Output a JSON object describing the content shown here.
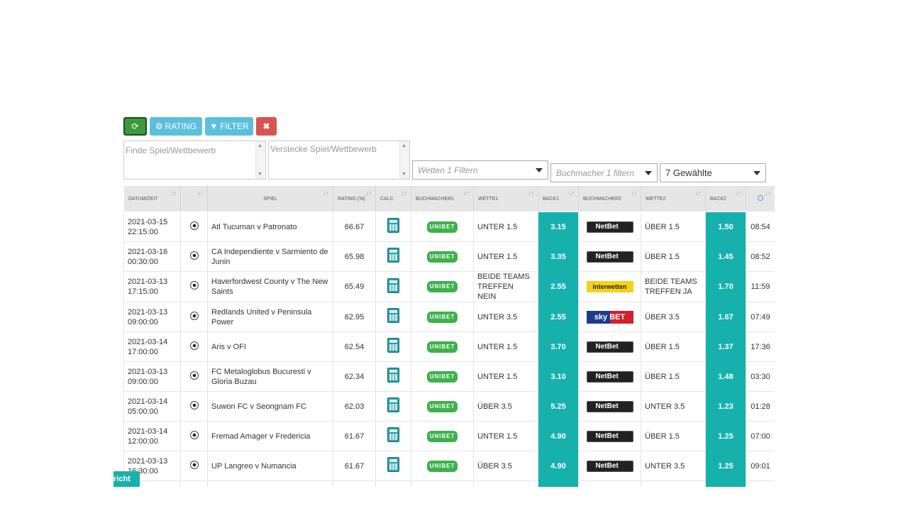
{
  "toolbar": {
    "rating_label": "RATING",
    "filter_label": "FILTER",
    "clear_label": "✖"
  },
  "filters": {
    "find_placeholder": "Finde Spiel/Wettbewerb",
    "hide_placeholder": "Verstecke Spiel/Wettbewerb",
    "wetten1_placeholder": "Wetten 1 Filtern",
    "bookmaker1_placeholder": "Buchmacher 1 filtern",
    "selected_label": "7 Gewählte"
  },
  "table": {
    "headers": {
      "datum": "DATUM/ZEIT",
      "spiel": "SPIEL",
      "rating": "RATING (%)",
      "calc": "CALC",
      "buch1": "BUCHMACHER1",
      "wette1": "WETTE1",
      "back1": "BACK1",
      "buch2": "BUCHMACHER2",
      "wette2": "WETTE2",
      "back2": "BACK2"
    },
    "rows": [
      {
        "date": "2021-03-15",
        "time": "22:15:00",
        "match": "Atl Tucuman v Patronato",
        "rating": "66.67",
        "bookie1": "UNIBET",
        "bet1": "UNTER 1.5",
        "back1": "3.15",
        "bookie2": "NetBet",
        "bet2": "ÜBER 1.5",
        "back2": "1.50",
        "updated": "08:54"
      },
      {
        "date": "2021-03-16",
        "time": "00:30:00",
        "match": "CA Independiente v Sarmiento de Junin",
        "rating": "65.98",
        "bookie1": "UNIBET",
        "bet1": "UNTER 1.5",
        "back1": "3.35",
        "bookie2": "NetBet",
        "bet2": "ÜBER 1.5",
        "back2": "1.45",
        "updated": "08:52"
      },
      {
        "date": "2021-03-13",
        "time": "17:15:00",
        "match": "Haverfordwest County v The New Saints",
        "rating": "65.49",
        "bookie1": "UNIBET",
        "bet1": "BEIDE TEAMS TREFFEN NEIN",
        "back1": "2.55",
        "bookie2": "interwetten",
        "bet2": "BEIDE TEAMS TREFFEN JA",
        "back2": "1.70",
        "updated": "11:59"
      },
      {
        "date": "2021-03-13",
        "time": "09:00:00",
        "match": "Redlands United v Peninsula Power",
        "rating": "62.95",
        "bookie1": "UNIBET",
        "bet1": "UNTER 3.5",
        "back1": "2.55",
        "bookie2": "sky BET",
        "bet2": "ÜBER 3.5",
        "back2": "1.67",
        "updated": "07:49"
      },
      {
        "date": "2021-03-14",
        "time": "17:00:00",
        "match": "Aris v OFI",
        "rating": "62.54",
        "bookie1": "UNIBET",
        "bet1": "UNTER 1.5",
        "back1": "3.70",
        "bookie2": "NetBet",
        "bet2": "ÜBER 1.5",
        "back2": "1.37",
        "updated": "17:36"
      },
      {
        "date": "2021-03-13",
        "time": "09:00:00",
        "match": "FC Metaloglobus Bucuresti v Gloria Buzau",
        "rating": "62.34",
        "bookie1": "UNIBET",
        "bet1": "UNTER 1.5",
        "back1": "3.10",
        "bookie2": "NetBet",
        "bet2": "ÜBER 1.5",
        "back2": "1.48",
        "updated": "03:30"
      },
      {
        "date": "2021-03-14",
        "time": "05:00:00",
        "match": "Suwon FC v Seongnam FC",
        "rating": "62.03",
        "bookie1": "UNIBET",
        "bet1": "ÜBER 3.5",
        "back1": "5.25",
        "bookie2": "NetBet",
        "bet2": "UNTER 3.5",
        "back2": "1.23",
        "updated": "01:28"
      },
      {
        "date": "2021-03-14",
        "time": "12:00:00",
        "match": "Fremad Amager v Fredericia",
        "rating": "61.67",
        "bookie1": "UNIBET",
        "bet1": "UNTER 1.5",
        "back1": "4.90",
        "bookie2": "NetBet",
        "bet2": "ÜBER 1.5",
        "back2": "1.25",
        "updated": "07:00"
      },
      {
        "date": "2021-03-13",
        "time": "16:30:00",
        "match": "UP Langreo v Numancia",
        "rating": "61.67",
        "bookie1": "UNIBET",
        "bet1": "ÜBER 3.5",
        "back1": "4.90",
        "bookie2": "NetBet",
        "bet2": "UNTER 3.5",
        "back2": "1.25",
        "updated": "09:01"
      }
    ]
  },
  "notification_tab": {
    "label": "richt"
  },
  "colors": {
    "back_cell": "#17b1ad",
    "info_button": "#5bc0de",
    "danger_button": "#d9534f",
    "success_button": "#3c9a3c"
  }
}
